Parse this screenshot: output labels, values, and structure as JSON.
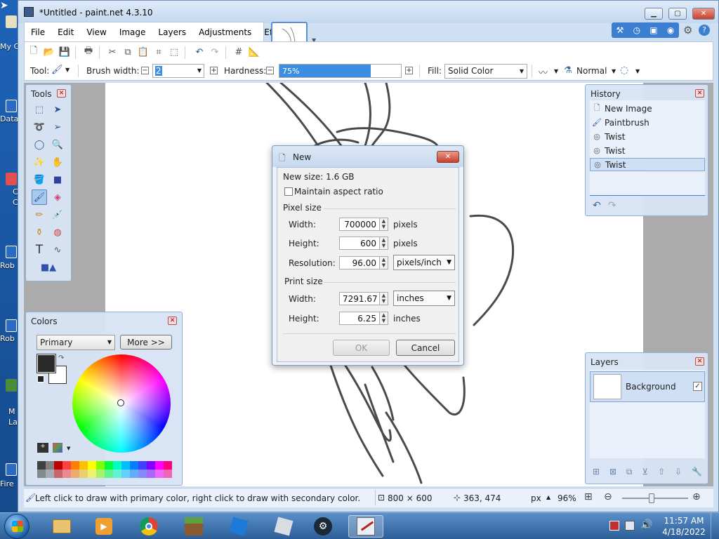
{
  "window": {
    "title": "*Untitled - paint.net 4.3.10"
  },
  "desktop": {
    "labels": [
      "My C",
      "Data",
      "C",
      "C",
      "Rob",
      "Rob",
      "M",
      "La",
      "Fire"
    ]
  },
  "menu": [
    "File",
    "Edit",
    "View",
    "Image",
    "Layers",
    "Adjustments",
    "Effects"
  ],
  "toolbar": {
    "tool_label": "Tool:",
    "brush_width_label": "Brush width:",
    "brush_width_value": "2",
    "hardness_label": "Hardness:",
    "hardness_value": "75%",
    "hardness_level": 0.75,
    "fill_label": "Fill:",
    "fill_value": "Solid Color",
    "blend_value": "Normal"
  },
  "tools_panel": {
    "title": "Tools"
  },
  "history_panel": {
    "title": "History",
    "items": [
      {
        "label": "New Image",
        "icon": "new-image-icon"
      },
      {
        "label": "Paintbrush",
        "icon": "paintbrush-icon"
      },
      {
        "label": "Twist",
        "icon": "twist-icon"
      },
      {
        "label": "Twist",
        "icon": "twist-icon"
      },
      {
        "label": "Twist",
        "icon": "twist-icon"
      }
    ],
    "selected_index": 4
  },
  "colors_panel": {
    "title": "Colors",
    "mode": "Primary",
    "more_label": "More >>",
    "primary_color": "#2b2b2b",
    "secondary_color": "#ffffff",
    "palette": [
      "#404040",
      "#808080",
      "#c00000",
      "#ff4040",
      "#ff8000",
      "#ffc000",
      "#ffff00",
      "#80ff00",
      "#00ff40",
      "#00ffc0",
      "#00c0ff",
      "#0080ff",
      "#4040ff",
      "#8000ff",
      "#ff00ff",
      "#ff0080"
    ]
  },
  "layers_panel": {
    "title": "Layers",
    "layers": [
      {
        "name": "Background",
        "visible": true
      }
    ]
  },
  "new_dialog": {
    "title": "New",
    "new_size": "New size: 1.6 GB",
    "maintain_aspect": "Maintain aspect ratio",
    "pixel_size_label": "Pixel size",
    "width_label": "Width:",
    "width_value": "700000",
    "width_unit": "pixels",
    "height_label": "Height:",
    "height_value": "600",
    "height_unit": "pixels",
    "resolution_label": "Resolution:",
    "resolution_value": "96.00",
    "resolution_unit": "pixels/inch",
    "print_size_label": "Print size",
    "print_width_label": "Width:",
    "print_width_value": "7291.67",
    "print_width_unit": "inches",
    "print_height_label": "Height:",
    "print_height_value": "6.25",
    "print_height_unit": "inches",
    "ok_label": "OK",
    "cancel_label": "Cancel"
  },
  "status": {
    "hint": "Left click to draw with primary color, right click to draw with secondary color.",
    "image_size": "800 × 600",
    "cursor_pos": "363, 474",
    "unit": "px",
    "zoom": "96%"
  },
  "taskbar": {
    "time": "11:57 AM",
    "date": "4/18/2022"
  },
  "colors": {
    "accent": "#3c7fd0",
    "selection": "#a8c8ee",
    "hardness_fill": "#3c8fe0"
  }
}
